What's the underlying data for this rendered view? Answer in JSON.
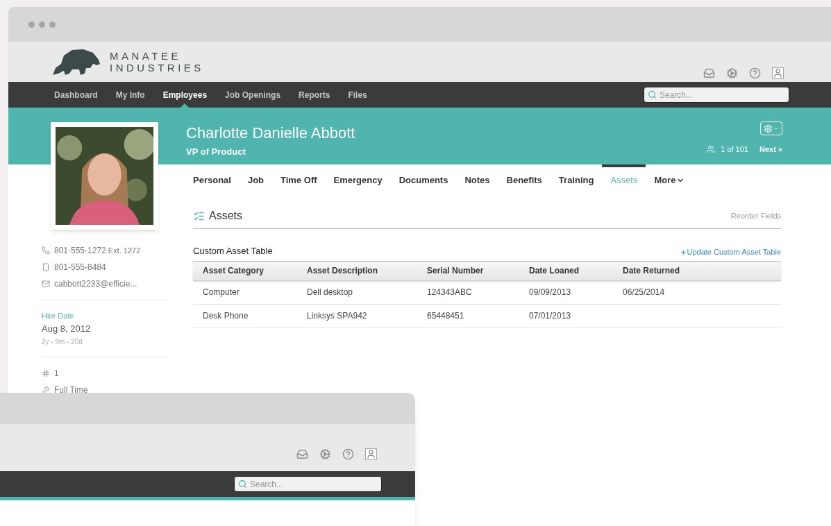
{
  "main_window": {
    "logo": {
      "line_1": "MANATEE",
      "line_2": "INDUSTRIES"
    },
    "nav": [
      {
        "label": "Dashboard",
        "selected": false
      },
      {
        "label": "My Info",
        "selected": false
      },
      {
        "label": "Employees",
        "selected": true
      },
      {
        "label": "Job Openings",
        "selected": false
      },
      {
        "label": "Reports",
        "selected": false
      },
      {
        "label": "Files",
        "selected": false
      }
    ],
    "search": {
      "placeholder": "Search..."
    },
    "employee": {
      "name": "Charlotte Danielle Abbott",
      "title": "VP of Product",
      "position": "1 of 101",
      "next": "Next »"
    },
    "tabs": [
      {
        "label": "Personal",
        "selected": false
      },
      {
        "label": "Job",
        "selected": false
      },
      {
        "label": "Time Off",
        "selected": false
      },
      {
        "label": "Emergency",
        "selected": false
      },
      {
        "label": "Documents",
        "selected": false
      },
      {
        "label": "Notes",
        "selected": false
      },
      {
        "label": "Benefits",
        "selected": false
      },
      {
        "label": "Training",
        "selected": false
      },
      {
        "label": "Assets",
        "selected": true
      },
      {
        "label": "More",
        "selected": false
      }
    ],
    "contact": [
      {
        "kind": "work",
        "value": "801-555-1272",
        "extra": "Ext. 1272"
      },
      {
        "kind": "mobile",
        "value": "801-555-8484"
      },
      {
        "kind": "email",
        "value": "cabbott2233@efficie..."
      }
    ],
    "hire": {
      "label": "Hire Date",
      "date": "Aug 8, 2012",
      "tenure": "2y - 9m - 20d"
    },
    "details": [
      {
        "kind": "number",
        "value": "1"
      },
      {
        "kind": "status",
        "value": "Full Time"
      }
    ],
    "section": {
      "title": "Assets",
      "action": "Reorder Fields"
    },
    "table": {
      "title": "Custom Asset Table",
      "action": "Update Custom Asset Table",
      "columns": [
        "Asset Category",
        "Asset Description",
        "Serial Number",
        "Date Loaned",
        "Date Returned"
      ],
      "rows": [
        [
          "Computer",
          "Dell desktop",
          "124343ABC",
          "09/09/2013",
          "06/25/2014"
        ],
        [
          "Desk Phone",
          "Linksys SPA942",
          "65448451",
          "07/01/2013",
          ""
        ]
      ]
    }
  },
  "second_window": {
    "search": {
      "placeholder": "Search..."
    }
  }
}
